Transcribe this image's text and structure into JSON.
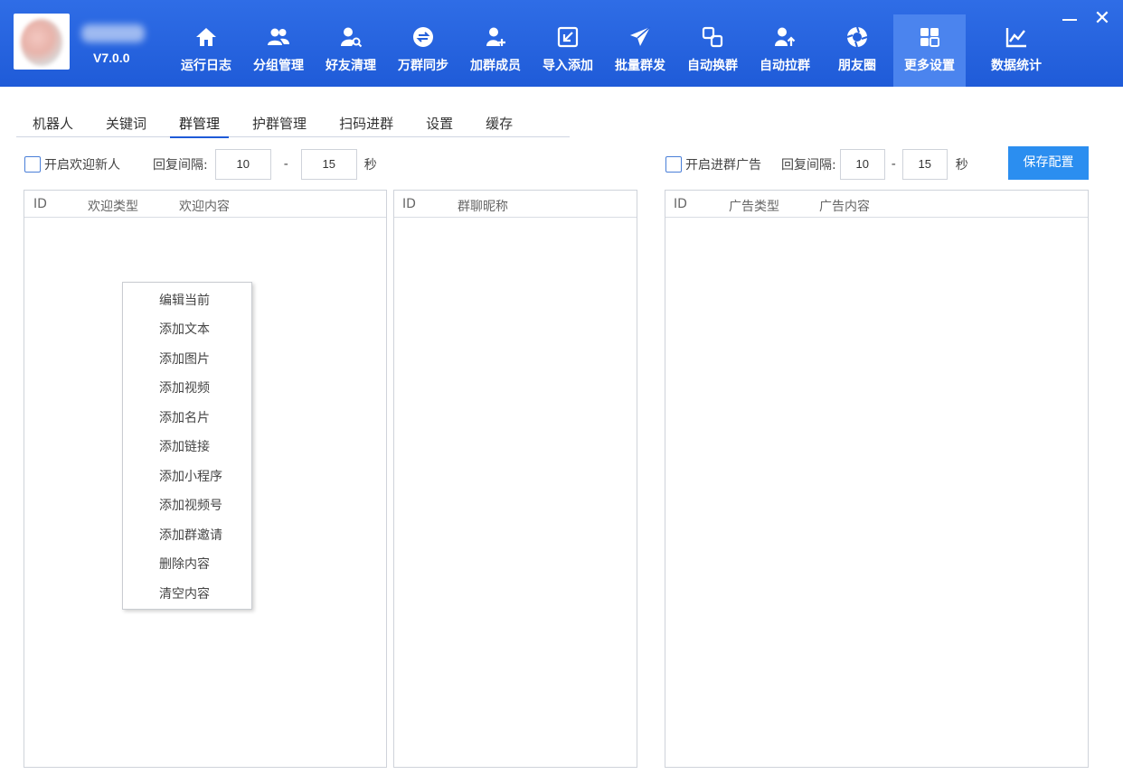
{
  "header": {
    "version": "V7.0.0",
    "nav": [
      {
        "label": "运行日志",
        "icon": "home-icon"
      },
      {
        "label": "分组管理",
        "icon": "users-icon"
      },
      {
        "label": "好友清理",
        "icon": "user-search-icon"
      },
      {
        "label": "万群同步",
        "icon": "sync-icon"
      },
      {
        "label": "加群成员",
        "icon": "user-add-icon"
      },
      {
        "label": "导入添加",
        "icon": "import-icon"
      },
      {
        "label": "批量群发",
        "icon": "send-icon"
      },
      {
        "label": "自动换群",
        "icon": "switch-group-icon"
      },
      {
        "label": "自动拉群",
        "icon": "pull-group-icon"
      },
      {
        "label": "朋友圈",
        "icon": "moments-icon"
      },
      {
        "label": "更多设置",
        "icon": "grid-icon"
      },
      {
        "label": "数据统计",
        "icon": "chart-icon"
      }
    ],
    "active_nav": "更多设置",
    "close_glyph": "✕"
  },
  "tabs": [
    "机器人",
    "关键词",
    "群管理",
    "护群管理",
    "扫码进群",
    "设置",
    "缓存"
  ],
  "active_tab": "群管理",
  "welcome": {
    "checkbox_label": "开启欢迎新人",
    "interval_label": "回复间隔:",
    "min": "10",
    "dash": "-",
    "max": "15",
    "unit": "秒",
    "columns": [
      "ID",
      "欢迎类型",
      "欢迎内容"
    ]
  },
  "group_list": {
    "columns": [
      "ID",
      "群聊昵称"
    ]
  },
  "ad": {
    "checkbox_label": "开启进群广告",
    "interval_label": "回复间隔:",
    "min": "10",
    "dash": "-",
    "max": "15",
    "unit": "秒",
    "save_label": "保存配置",
    "columns": [
      "ID",
      "广告类型",
      "广告内容"
    ]
  },
  "context_menu": [
    "编辑当前",
    "添加文本",
    "添加图片",
    "添加视频",
    "添加名片",
    "添加链接",
    "添加小程序",
    "添加视频号",
    "添加群邀请",
    "删除内容",
    "清空内容"
  ]
}
